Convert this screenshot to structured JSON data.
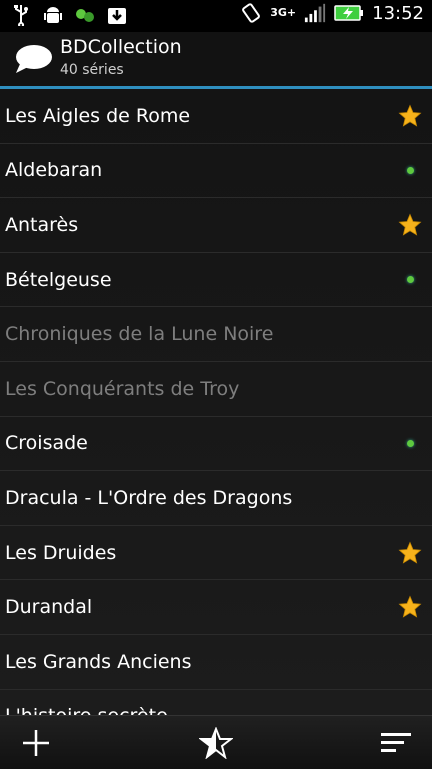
{
  "status_bar": {
    "time": "13:52",
    "network": "3G+",
    "icons": [
      "usb-icon",
      "android-debug-icon",
      "sync-icon",
      "download-icon",
      "rotate-icon",
      "signal-icon",
      "battery-icon"
    ],
    "colors": {
      "battery": "#3fcf3f"
    }
  },
  "action_bar": {
    "title": "BDCollection",
    "subtitle": "40 séries",
    "icon": "speech-bubble-icon",
    "accent": "#2f8fbf"
  },
  "list": {
    "items": [
      {
        "label": "Les Aigles de Rome",
        "mark": "star",
        "dim": false
      },
      {
        "label": "Aldebaran",
        "mark": "dot",
        "dim": false
      },
      {
        "label": "Antarès",
        "mark": "star",
        "dim": false
      },
      {
        "label": "Bételgeuse",
        "mark": "dot",
        "dim": false
      },
      {
        "label": "Chroniques de la Lune Noire",
        "mark": "none",
        "dim": true
      },
      {
        "label": "Les Conquérants de Troy",
        "mark": "none",
        "dim": true
      },
      {
        "label": "Croisade",
        "mark": "dot",
        "dim": false
      },
      {
        "label": "Dracula - L'Ordre des Dragons",
        "mark": "none",
        "dim": false
      },
      {
        "label": "Les Druides",
        "mark": "star",
        "dim": false
      },
      {
        "label": "Durandal",
        "mark": "star",
        "dim": false
      },
      {
        "label": "Les Grands Anciens",
        "mark": "none",
        "dim": false
      },
      {
        "label": "L'histoire secrète",
        "mark": "none",
        "dim": false
      }
    ],
    "colors": {
      "star": "#f6b21b",
      "dot": "#5ec93f",
      "dim_text": "#7e7e7e"
    }
  },
  "bottom_bar": {
    "buttons": [
      "add-icon",
      "favorite-icon",
      "sort-icon"
    ]
  }
}
